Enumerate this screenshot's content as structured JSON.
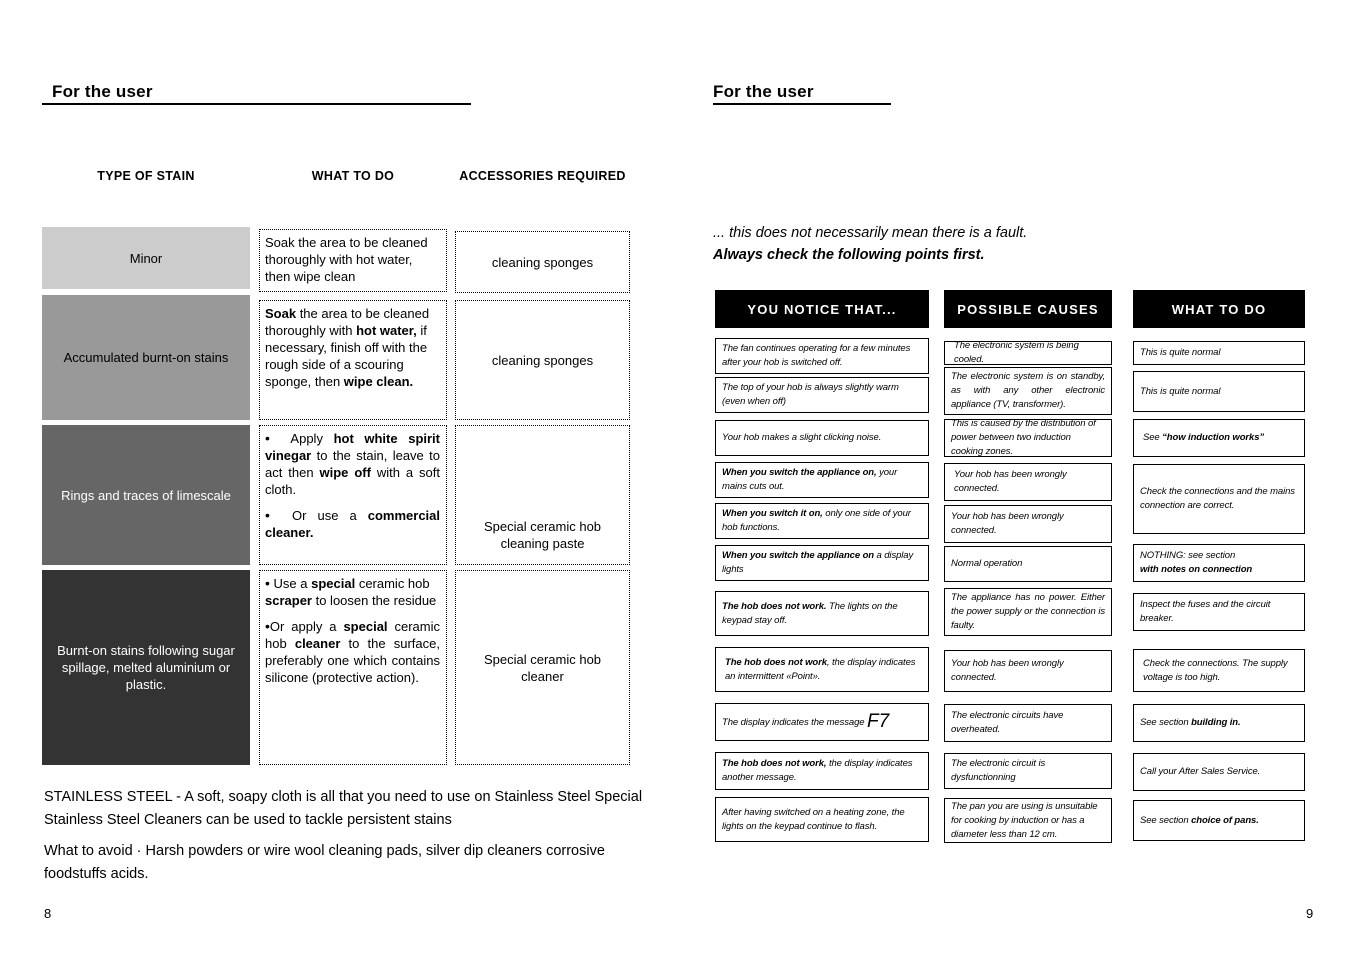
{
  "left_page": {
    "running_head": "For the user",
    "page_number": "8",
    "table": {
      "headers": {
        "type_of_stain": "TYPE OF STAIN",
        "what_to_do": "WHAT TO DO",
        "accessories_required": "ACCESSORIES REQUIRED"
      },
      "rows": [
        {
          "stain": "Minor",
          "stain_fill": "#cccccc",
          "stain_text_color": "#000000",
          "what_to_do_plain": "Soak the area to be cleaned thoroughly with hot water, then wipe clean",
          "accessories": "cleaning sponges"
        },
        {
          "stain": "Accumulated burnt-on stains",
          "stain_fill": "#999999",
          "stain_text_color": "#000000",
          "accessories": "cleaning sponges"
        },
        {
          "stain": "Rings and traces of limescale",
          "stain_fill": "#666666",
          "stain_text_color": "#ffffff",
          "accessories": "Special ceramic hob cleaning paste"
        },
        {
          "stain": "Burnt-on stains following sugar spillage, melted aluminium or plastic.",
          "stain_fill": "#333333",
          "stain_text_color": "#ffffff",
          "accessories": "Special ceramic hob cleaner"
        }
      ]
    },
    "notes": {
      "stainless_steel": "STAINLESS STEEL - A soft, soapy cloth is all that you need to use on Stainless Steel Special Stainless Steel Cleaners can be used to tackle persistent stains",
      "what_to_avoid": "What to avoid · Harsh powders or wire wool cleaning pads, silver dip cleaners corrosive foodstuffs acids."
    }
  },
  "right_page": {
    "running_head": "For the user",
    "page_number": "9",
    "intro_line_1": "... this does not necessarily mean there is a fault.",
    "intro_line_2": "Always check the following points first.",
    "matrix": {
      "headers": {
        "notice": "YOU NOTICE THAT...",
        "causes": "POSSIBLE CAUSES",
        "action": "WHAT TO DO"
      },
      "notice": [
        "The fan continues operating for a few minutes after your hob is switched off.",
        "The top of your hob is always slightly warm (even when off)",
        "Your hob makes a slight clicking noise."
      ],
      "causes": [
        "The electronic system is being cooled.",
        "The electronic system is on standby, as with any other electronic appliance (TV, transformer).",
        "This is caused by the distribution of power between two induction cooking zones.",
        "Your hob has been wrongly connected.",
        "Your hob has been wrongly connected.",
        "Normal operation",
        "The appliance has no power. Either the power supply or the connection is faulty.",
        "Your hob has been wrongly connected.",
        "The electronic circuits have overheated.",
        "The electronic circuit is dysfunctionning",
        "The pan you are using is unsuitable for cooking by induction or has a diameter less than 12 cm."
      ],
      "actions": [
        "This is quite normal",
        "This is quite normal",
        "Check the connections and the mains connection are correct.",
        "Inspect the fuses and the circuit breaker.",
        "Check the connections. The supply voltage is too high.",
        "Call your After Sales Service."
      ],
      "action_see_induction_prefix": "See ",
      "action_see_induction_bold": "“how induction works”",
      "action_nothing_line1": "NOTHING: see section",
      "action_nothing_line2": "with notes on connection",
      "action_building_prefix": "See section ",
      "action_building_bold": "building in.",
      "action_pans_prefix": "See section ",
      "action_pans_bold": "choice of pans.",
      "notice_mains_bold": "When you switch the appliance on,",
      "notice_mains_rest": " your mains cuts out.",
      "notice_oneside_bold": "When you switch it on,",
      "notice_oneside_rest": " only one side of your hob functions.",
      "notice_display_bold": "When you switch the appliance on",
      "notice_display_rest": " a display lights",
      "notice_keypad_bold": "The hob does not work.",
      "notice_keypad_rest": " The lights on the keypad stay off.",
      "notice_point_bold": "The hob does not work",
      "notice_point_rest": ", the display indicates an intermittent «Point».",
      "notice_f7_prefix": "The display indicates the message ",
      "notice_f7_code": "F7",
      "notice_other_bold": "The hob does not work,",
      "notice_other_rest": " the display indicates another message.",
      "notice_flash": "After having switched on a heating zone, the lights on the keypad continue to flash."
    }
  },
  "cells": {
    "r2_what": {
      "s1": "Soak",
      "t1": " the area to be cleaned thoroughly with ",
      "s2": "hot water,",
      "t2": " if necessary, finish off with the rough side of a scouring sponge, then ",
      "s3": "wipe clean."
    },
    "r3_what": {
      "b1_t1": "Apply ",
      "b1_s1": "hot white spirit vinegar",
      "b1_t2": " to the stain, leave to act then ",
      "b1_s2": "wipe off",
      "b1_t3": " with a soft cloth.",
      "b2_t1": "Or use a ",
      "b2_s1": "commercial cleaner."
    },
    "r4_what": {
      "b1_t1": "Use a ",
      "b1_s1": "special",
      "b1_t2": " ceramic hob ",
      "b1_s2": "scraper",
      "b1_t3": " to loosen the residue",
      "b2_t1": "Or apply a ",
      "b2_s1": "special",
      "b2_t2": " ceramic hob ",
      "b2_s2": "cleaner",
      "b2_t3": " to the surface, preferably one which contains silicone (protective action)."
    }
  }
}
